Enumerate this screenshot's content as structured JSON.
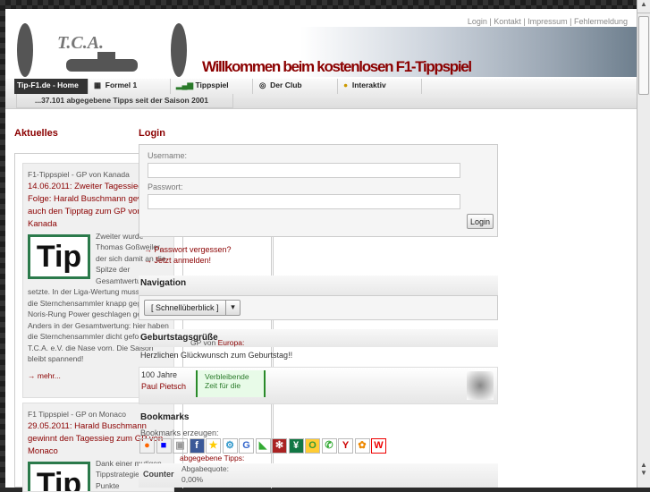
{
  "top_links": [
    "Login",
    "Kontakt",
    "Impressum",
    "Fehlermeldung"
  ],
  "logo_text": "T.C.A.",
  "welcome": "Willkommen beim kostenlosen F1-Tippspiel",
  "nav": {
    "home": "Tip-F1.de - Home",
    "items": [
      "Formel 1",
      "Tippspiel",
      "Der Club",
      "Interaktiv"
    ],
    "ticker": "...37.101 abgegebene Tipps seit der Saison 2001"
  },
  "aktuelles": {
    "title": "Aktuelles",
    "articles": [
      {
        "category": "F1-Tippspiel - GP von Kanada",
        "headline": "14.06.2011: Zweiter Tagessieg in Folge: Harald Buschmann gewinnt auch den Tipptag zum GP von Kanada",
        "image": "Tip",
        "text": "Zweiter wurde Thomas Goßweiler, der sich damit an die Spitze der Gesamtwertung setzte. In der Liga-Wertung musste sich die Sternchensammler knapp gegen das Noris-Rung Power geschlagen geben. Anders in der Gesamtwertung: hier haben die Sternchensammler dicht gefolgt vom T.C.A. e.V. die Nase vorn. Die Saison bleibt spannend!",
        "more": "→ mehr..."
      },
      {
        "category": "F1 Tippspiel - GP on Monaco",
        "headline": "29.05.2011: Harald Buschmann gewinnt den Tagessieg zum GP von Monaco",
        "image": "Tip",
        "text": "Dank einer mutigen Tippstrategie 10 Punkte"
      }
    ]
  },
  "middle": {
    "gp_label": "GP von",
    "gp_link": "Europa:",
    "green_text": "Verbleibende Zeit für die",
    "abgegebene": "abgegebene Tipps:",
    "quote": "Abgabequote:",
    "quote_val": "0,00%"
  },
  "login": {
    "title": "Login",
    "username_label": "Username:",
    "username_value": "",
    "password_label": "Passwort:",
    "password_value": "",
    "button": "Login",
    "forgot": "→ Passwort vergessen?",
    "register": "→ Jetzt anmelden!"
  },
  "navigation": {
    "title": "Navigation",
    "select": "[ Schnellüberblick ]"
  },
  "birthday": {
    "title": "Geburtstagsgrüße",
    "text": "Herzlichen Glückwunsch zum Geburtstag!!",
    "age": "100 Jahre",
    "name": "Paul Pietsch"
  },
  "bookmarks": {
    "title": "Bookmarks",
    "label": "Bookmarks erzeugen:",
    "icons": [
      "mister-wong",
      "delicious",
      "digg",
      "facebook",
      "favoriten",
      "linkarena",
      "google",
      "oneview",
      "yigg",
      "webnews",
      "folkd",
      "icio",
      "yahoo",
      "seekxl",
      "wikio"
    ]
  },
  "counter": {
    "title": "Counter"
  }
}
